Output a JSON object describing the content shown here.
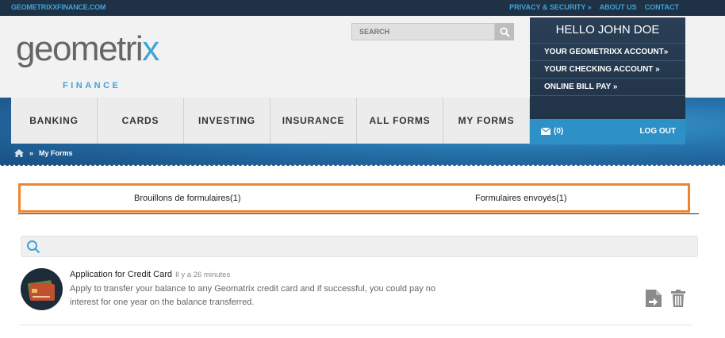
{
  "topbar": {
    "site": "GEOMETRIXXFINANCE.COM",
    "links": [
      "PRIVACY & SECURITY »",
      "ABOUT US",
      "CONTACT"
    ]
  },
  "logo": {
    "word_start": "geometri",
    "word_end": "x",
    "sub": "FINANCE"
  },
  "search": {
    "placeholder": "SEARCH"
  },
  "account": {
    "greeting": "HELLO JOHN DOE",
    "links": [
      "YOUR GEOMETRIXX ACCOUNT»",
      "YOUR CHECKING ACCOUNT »",
      "ONLINE BILL PAY »"
    ],
    "mail_count": "(0)",
    "logout": "LOG OUT"
  },
  "nav": {
    "tabs": [
      "BANKING",
      "CARDS",
      "INVESTING",
      "INSURANCE",
      "ALL FORMS",
      "MY FORMS"
    ]
  },
  "breadcrumb": {
    "separator": "»",
    "current": "My Forms"
  },
  "form_tabs": [
    "Brouillons de formulaires(1)",
    "Formulaires envoyés(1)"
  ],
  "list": {
    "items": [
      {
        "title": "Application for Credit Card",
        "time": "Il y a 26 minutes",
        "description": "Apply to transfer your balance to any Geomatrix credit card and if successful, you could pay no interest for one year on the balance transferred."
      }
    ]
  },
  "colors": {
    "accent": "#3fa3d8",
    "highlight_border": "#f0842c",
    "dark_navy": "#1f3144"
  },
  "icons": [
    "search-icon",
    "mail-icon",
    "home-icon",
    "credit-card-icon",
    "open-form-icon",
    "trash-icon"
  ]
}
